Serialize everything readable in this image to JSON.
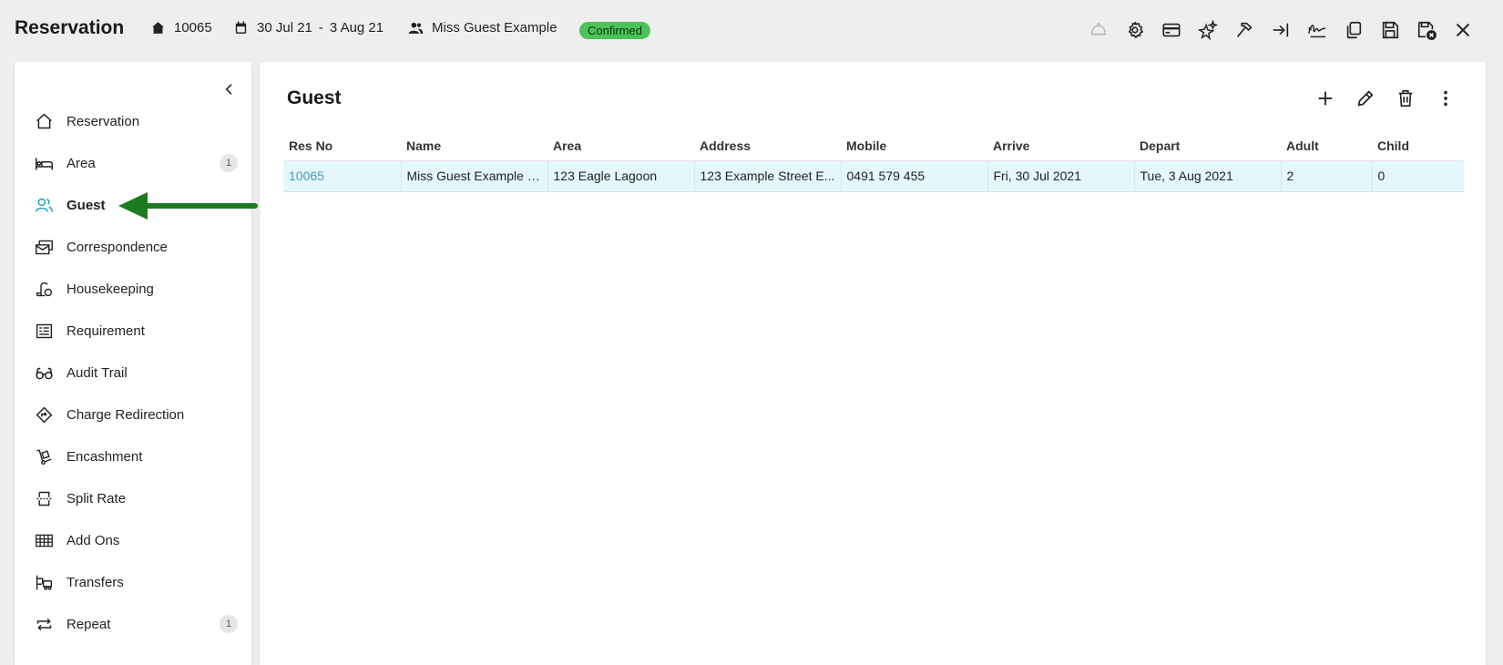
{
  "header": {
    "title": "Reservation",
    "res_no": "10065",
    "date_from": "30 Jul 21",
    "date_sep": "-",
    "date_to": "3 Aug 21",
    "guest_name": "Miss Guest Example",
    "status": "Confirmed",
    "status_color": "#4cc35a"
  },
  "toolbar": {
    "icons": [
      "bell-icon",
      "gear-icon",
      "credit-card-icon",
      "sparkle-star-icon",
      "hammer-icon",
      "check-in-icon",
      "signature-icon",
      "copy-icon",
      "save-icon",
      "save-close-icon",
      "close-icon"
    ]
  },
  "sidebar": {
    "items": [
      {
        "label": "Reservation",
        "icon": "home-icon",
        "badge": ""
      },
      {
        "label": "Area",
        "icon": "bed-icon",
        "badge": "1"
      },
      {
        "label": "Guest",
        "icon": "users-icon",
        "badge": "",
        "active": true
      },
      {
        "label": "Correspondence",
        "icon": "mail-stack-icon",
        "badge": ""
      },
      {
        "label": "Housekeeping",
        "icon": "vacuum-icon",
        "badge": ""
      },
      {
        "label": "Requirement",
        "icon": "list-icon",
        "badge": ""
      },
      {
        "label": "Audit Trail",
        "icon": "glasses-icon",
        "badge": ""
      },
      {
        "label": "Charge Redirection",
        "icon": "direction-sign-icon",
        "badge": ""
      },
      {
        "label": "Encashment",
        "icon": "hand-truck-icon",
        "badge": ""
      },
      {
        "label": "Split Rate",
        "icon": "split-icon",
        "badge": ""
      },
      {
        "label": "Add Ons",
        "icon": "grid-icon",
        "badge": ""
      },
      {
        "label": "Transfers",
        "icon": "transfer-icon",
        "badge": ""
      },
      {
        "label": "Repeat",
        "icon": "repeat-icon",
        "badge": "1"
      }
    ]
  },
  "main": {
    "title": "Guest",
    "columns": [
      "Res No",
      "Name",
      "Area",
      "Address",
      "Mobile",
      "Arrive",
      "Depart",
      "Adult",
      "Child"
    ],
    "rows": [
      [
        "10065",
        "Miss Guest Example (...",
        "123 Eagle Lagoon",
        "123 Example Street E...",
        "0491 579 455",
        "Fri, 30 Jul 2021",
        "Tue, 3 Aug 2021",
        "2",
        "0"
      ]
    ]
  },
  "colors": {
    "accent": "#1aa6b7",
    "arrow": "#1e7a1e",
    "row_highlight": "#e4f7fc",
    "link": "#4a9ab8"
  }
}
